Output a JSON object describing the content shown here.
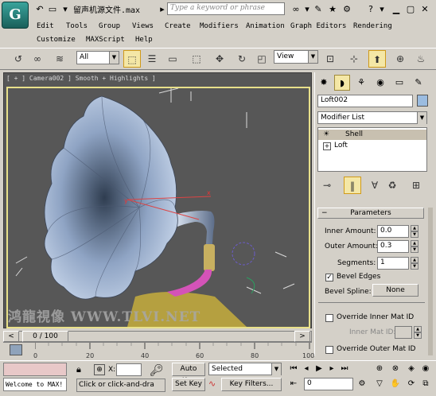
{
  "titlebar": {
    "logo": "G",
    "title": "留声机源文件.max",
    "search_placeholder": "Type a keyword or phrase",
    "icons": [
      "app-logo-icon",
      "undo-icon",
      "new-file-icon",
      "open-icon",
      "save-icon",
      "more-icon",
      "binoculars-icon",
      "comm-icon",
      "star-icon",
      "help-icon",
      "minimize-icon",
      "maximize-icon",
      "close-icon"
    ]
  },
  "menu": {
    "row1": [
      "Edit",
      "Tools",
      "Group",
      "Views",
      "Create",
      "Modifiers",
      "Animation",
      "Graph Editors",
      "Rendering"
    ],
    "row2": [
      "Customize",
      "MAXScript",
      "Help"
    ]
  },
  "toolbar": {
    "filter_value": "All",
    "ref_coord_value": "View"
  },
  "viewport": {
    "label": "[ + ] Camera002 ] Smooth + Highlights ]",
    "watermark": "鸿龍視像 WWW.TLVI.NET"
  },
  "command_panel": {
    "object_name": "Loft002",
    "object_color": "#9bbce0",
    "modifier_list": "Modifier List",
    "stack_items": [
      "Shell",
      "Loft"
    ],
    "rollout_title": "Parameters",
    "inner_amount_label": "Inner Amount:",
    "inner_amount_value": "0.0",
    "outer_amount_label": "Outer Amount:",
    "outer_amount_value": "0.3",
    "segments_label": "Segments:",
    "segments_value": "1",
    "bevel_edges_label": "Bevel Edges",
    "bevel_edges_checked": true,
    "bevel_spline_label": "Bevel Spline:",
    "bevel_spline_value": "None",
    "override_inner_label": "Override Inner Mat ID",
    "inner_mat_id_label": "Inner Mat ID:",
    "inner_mat_id_value": "",
    "override_outer_label": "Override Outer Mat ID"
  },
  "timeline": {
    "frame_counter": "0 / 100",
    "ticks": [
      "0",
      "20",
      "40",
      "60",
      "80",
      "100"
    ]
  },
  "status": {
    "listener_text": "Welcome to MAX!",
    "prompt_text": "Click or click-and-dra",
    "x_label": "X:",
    "x_value": "",
    "auto_key": "Auto Key",
    "set_key": "Set Key",
    "selected_dropdown": "Selected",
    "key_filters": "Key Filters...",
    "current_frame": "0"
  }
}
